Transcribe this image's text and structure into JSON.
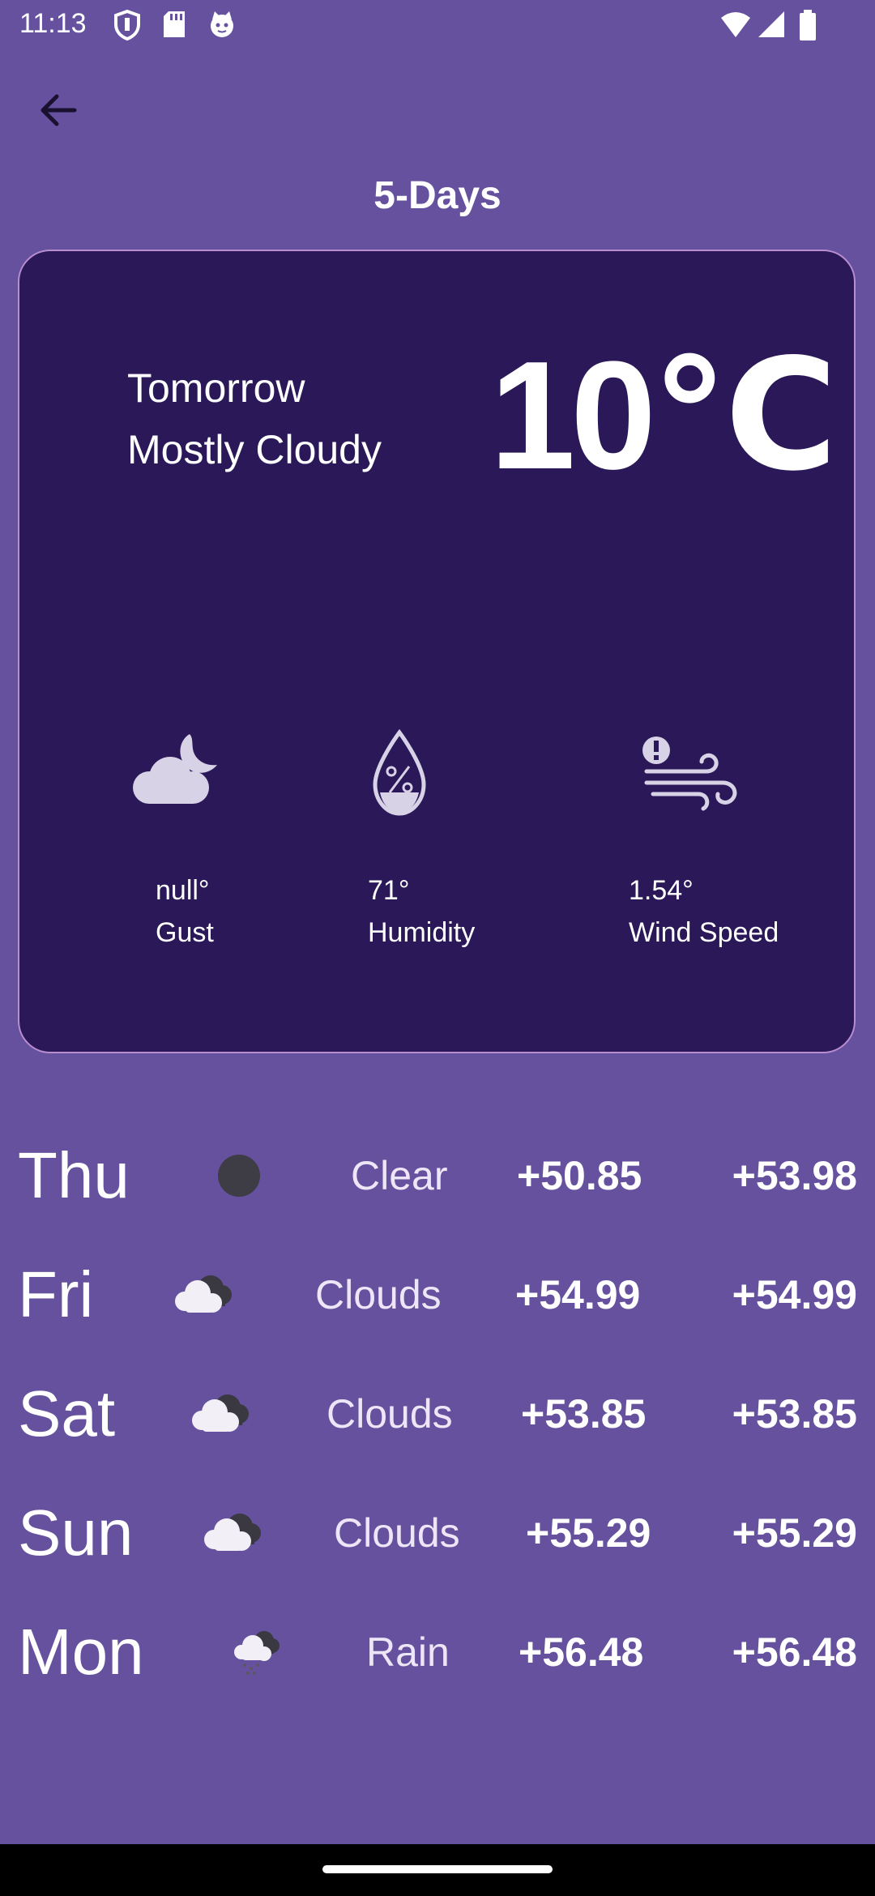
{
  "status_bar": {
    "time": "11:13",
    "icons": [
      "shield-icon",
      "sd-card-icon",
      "cat-face-icon",
      "wifi-icon",
      "signal-icon",
      "battery-icon"
    ]
  },
  "header": {
    "title": "5-Days",
    "back_icon": "arrow-left-icon"
  },
  "card": {
    "day": "Tomorrow",
    "description": "Mostly Cloudy",
    "temperature": "10℃",
    "metrics": [
      {
        "icon": "cloud-moon-icon",
        "value": "null°",
        "label": "Gust"
      },
      {
        "icon": "humidity-drop-icon",
        "value": "71°",
        "label": "Humidity"
      },
      {
        "icon": "wind-alert-icon",
        "value": "1.54°",
        "label": "Wind Speed"
      }
    ]
  },
  "forecast": [
    {
      "day": "Thu",
      "icon": "clear-dot-icon",
      "condition": "Clear",
      "min": "+50.85",
      "max": "+53.98"
    },
    {
      "day": "Fri",
      "icon": "clouds-icon",
      "condition": "Clouds",
      "min": "+54.99",
      "max": "+54.99"
    },
    {
      "day": "Sat",
      "icon": "clouds-icon",
      "condition": "Clouds",
      "min": "+53.85",
      "max": "+53.85"
    },
    {
      "day": "Sun",
      "icon": "clouds-icon",
      "condition": "Clouds",
      "min": "+55.29",
      "max": "+55.29"
    },
    {
      "day": "Mon",
      "icon": "rain-cloud-icon",
      "condition": "Rain",
      "min": "+56.48",
      "max": "+56.48"
    }
  ],
  "colors": {
    "background": "#65519E",
    "card_background": "#2A1858",
    "card_border": "#B98ED1",
    "text": "#FFFFFF"
  }
}
